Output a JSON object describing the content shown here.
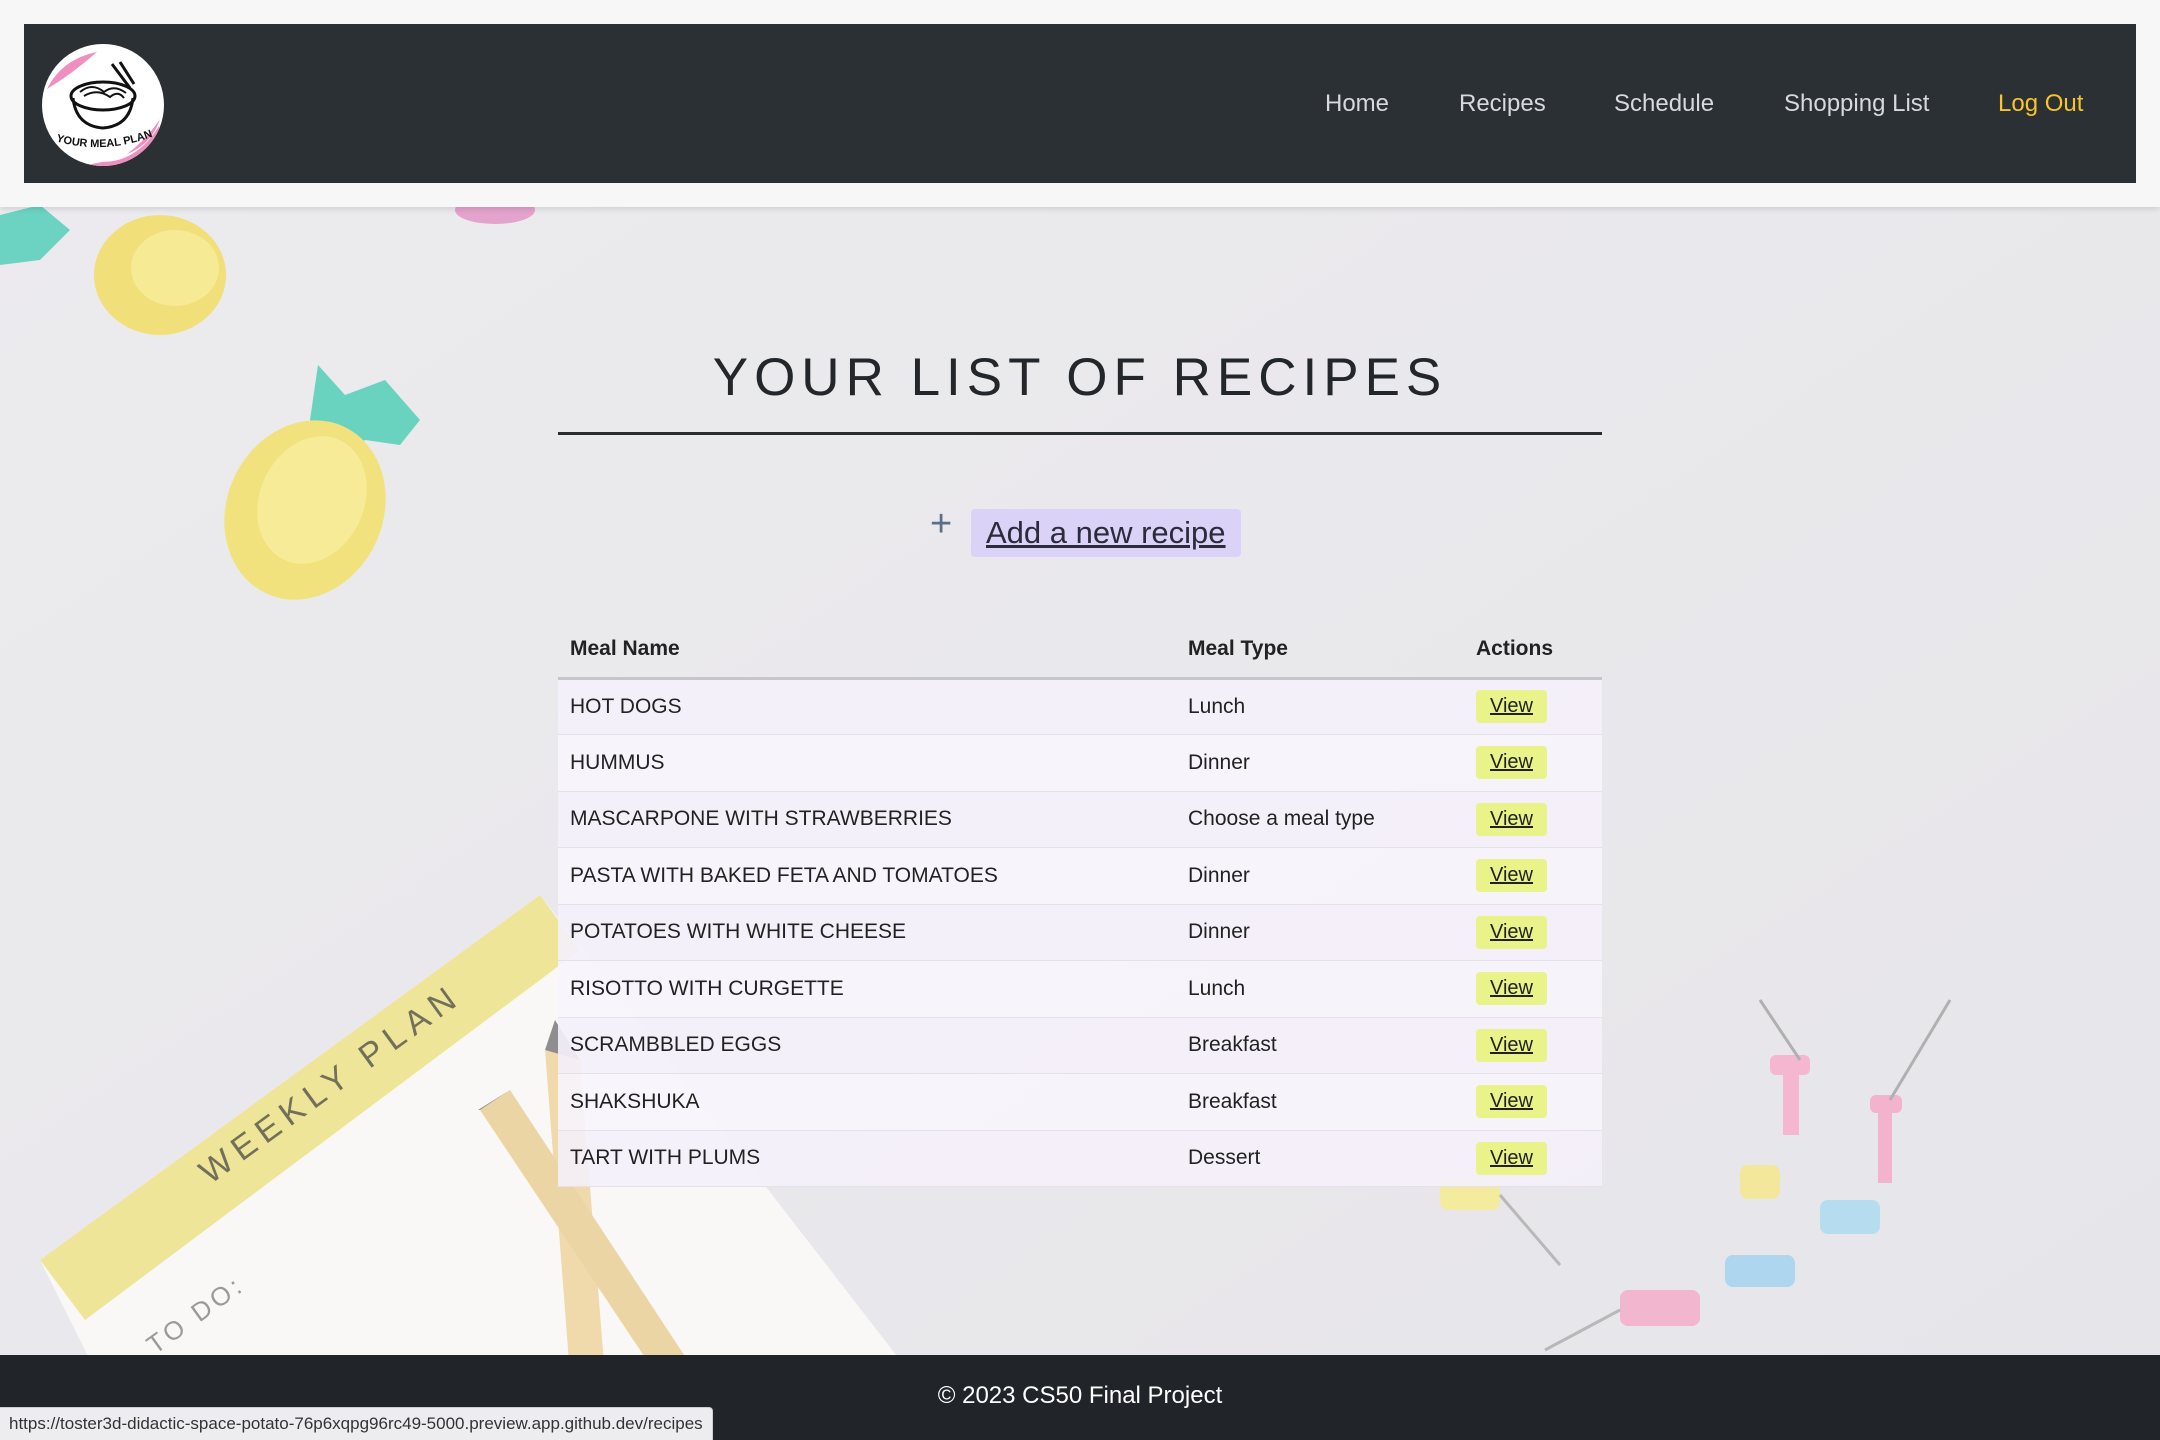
{
  "brand": {
    "logo_text": "YOUR MEAL PLANNER"
  },
  "nav": {
    "home": "Home",
    "recipes": "Recipes",
    "schedule": "Schedule",
    "shopping_list": "Shopping List",
    "logout": "Log Out"
  },
  "page": {
    "title": "YOUR LIST OF RECIPES",
    "add_plus": "+",
    "add_label": "Add a new recipe"
  },
  "table": {
    "headers": {
      "name": "Meal Name",
      "type": "Meal Type",
      "actions": "Actions"
    },
    "rows": [
      {
        "name": "HOT DOGS",
        "type": "Lunch",
        "action": "View"
      },
      {
        "name": "HUMMUS",
        "type": "Dinner",
        "action": "View"
      },
      {
        "name": "MASCARPONE WITH STRAWBERRIES",
        "type": "Choose a meal type",
        "action": "View"
      },
      {
        "name": "PASTA WITH BAKED FETA AND TOMATOES",
        "type": "Dinner",
        "action": "View"
      },
      {
        "name": "POTATOES WITH WHITE CHEESE",
        "type": "Dinner",
        "action": "View"
      },
      {
        "name": "RISOTTO WITH CURGETTE",
        "type": "Lunch",
        "action": "View"
      },
      {
        "name": "SCRAMBBLED EGGS",
        "type": "Breakfast",
        "action": "View"
      },
      {
        "name": "SHAKSHUKA",
        "type": "Breakfast",
        "action": "View"
      },
      {
        "name": "TART WITH PLUMS",
        "type": "Dessert",
        "action": "View"
      }
    ]
  },
  "background": {
    "notepad_label": "WEEKLY PLAN",
    "notepad_todo": "TO DO:"
  },
  "footer": {
    "text": "© 2023 CS50 Final Project"
  },
  "status_bar": {
    "url": "https://toster3d-didactic-space-potato-76p6xqpg96rc49-5000.preview.app.github.dev/recipes"
  },
  "colors": {
    "navbar": "#2b3035",
    "nav_text": "#d7d9db",
    "logout": "#f7c42a",
    "add_link_bg": "#dad2f7",
    "view_button_bg": "#eaf38a",
    "footer": "#212529"
  }
}
